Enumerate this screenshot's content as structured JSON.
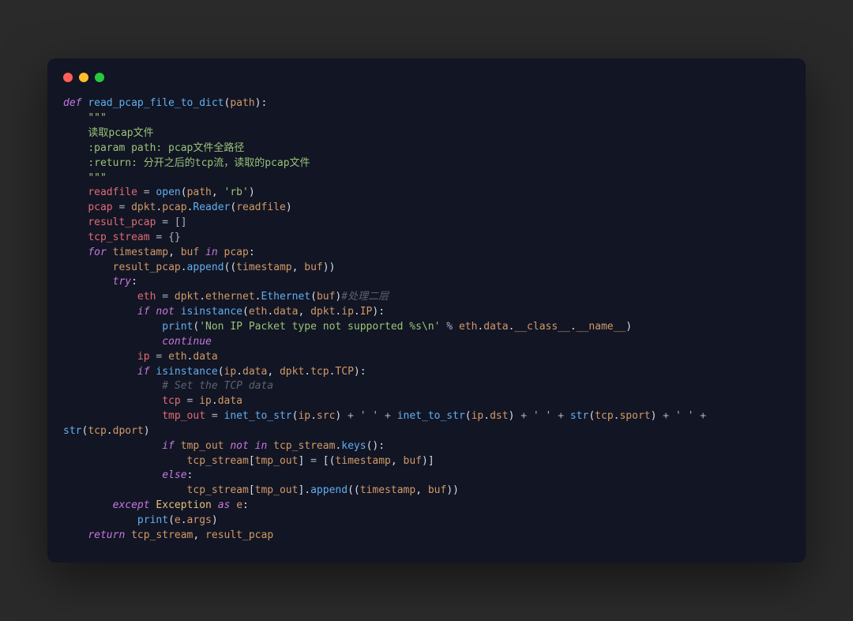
{
  "window": {
    "dots": [
      "red",
      "yellow",
      "green"
    ]
  },
  "code": {
    "t": {
      "def": "def",
      "fname": "read_pcap_file_to_dict",
      "path": "path",
      "tq": "\"\"\"",
      "doc1": "读取pcap文件",
      "doc2": ":param path: pcap文件全路径",
      "doc3": ":return: 分开之后的tcp流，读取的pcap文件",
      "readfile": "readfile",
      "eq": " = ",
      "open": "open",
      "rb": "'rb'",
      "pcap": "pcap",
      "dpkt": "dpkt",
      "Reader": "Reader",
      "result_pcap": "result_pcap",
      "emptylist": "[]",
      "tcp_stream": "tcp_stream",
      "emptydict": "{}",
      "for": "for",
      "timestamp": "timestamp",
      "buf": "buf",
      "in": "in",
      "append": "append",
      "try": "try",
      "eth": "eth",
      "ethernet": "ethernet",
      "Ethernet": "Ethernet",
      "cmt_layer2": "#处理二层",
      "if": "if",
      "not": "not",
      "isinstance": "isinstance",
      "data": "data",
      "ip_mod": "ip",
      "IP": "IP",
      "print": "print",
      "nonip": "'Non IP Packet type not supported %s\\n'",
      "pct": " % ",
      "class": "__class__",
      "name": "__name__",
      "continue": "continue",
      "ip": "ip",
      "tcp_mod": "tcp",
      "TCP": "TCP",
      "cmt_settcp": "# Set the TCP data",
      "tcp": "tcp",
      "tmp_out": "tmp_out",
      "inet_to_str": "inet_to_str",
      "src": "src",
      "dst": "dst",
      "space": "' '",
      "plus": " + ",
      "str": "str",
      "sport": "sport",
      "dport": "dport",
      "keys": "keys",
      "else": "else",
      "except": "except",
      "Exception": "Exception",
      "as": "as",
      "e": "e",
      "args": "args",
      "return": "return"
    }
  }
}
